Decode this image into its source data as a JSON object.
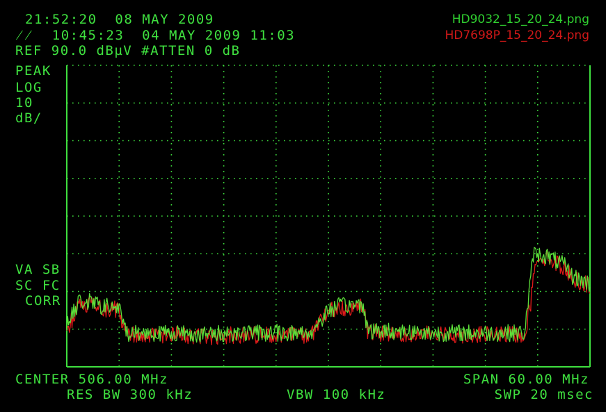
{
  "header": {
    "clock": "21:52:20  08 MAY 2009",
    "trace_stamp": "10:45:23  04 MAY 2009 11:03",
    "ref_line": "REF 90.0 dBµV #ATTEN 0 dB"
  },
  "files": {
    "green": "HD9032_15_20_24.png",
    "red": "HD7698P_15_20_24.png"
  },
  "left_labels": {
    "detector": "PEAK",
    "scale_type": "LOG",
    "scale_value": "10",
    "scale_unit": "dB/",
    "flags1": "VA SB",
    "flags2": "SC FC",
    "flags3": "CORR"
  },
  "footer": {
    "center": "CENTER 506.00 MHz",
    "span": "SPAN 60.00 MHz",
    "res_bw": "RES BW 300 kHz",
    "vbw": "VBW 100 kHz",
    "swp": "SWP 20 msec"
  },
  "colors": {
    "green_trace": "#5de03a",
    "red_trace": "#e01a1a",
    "text": "#3fe03f",
    "grid": "#3fe03f"
  },
  "chart_data": {
    "type": "line",
    "x_unit": "MHz",
    "y_unit": "dBµV",
    "xlim": [
      476,
      536
    ],
    "ylim": [
      10,
      90
    ],
    "grid": true,
    "series": [
      {
        "name": "HD9032_15_20_24.png",
        "color": "#5de03a",
        "x": [
          476,
          477.5,
          479,
          480,
          481,
          482,
          482.5,
          483,
          486,
          489,
          492,
          495,
          498,
          500,
          504,
          506,
          507,
          509,
          510,
          510.5,
          511,
          514,
          518,
          522,
          526,
          528.5,
          529,
          529.5,
          531,
          533,
          534,
          535,
          536
        ],
        "y": [
          21,
          27.5,
          27,
          26,
          26,
          25.5,
          21,
          19,
          19,
          19,
          18.5,
          19,
          19,
          19,
          19,
          25,
          26,
          26.5,
          26.5,
          20,
          19.5,
          19.5,
          19,
          19,
          19,
          19,
          29,
          40,
          39.5,
          37,
          34,
          33,
          32
        ]
      },
      {
        "name": "HD7698P_15_20_24.png",
        "color": "#e01a1a",
        "x": [
          476,
          477.5,
          479,
          480,
          481,
          482,
          482.5,
          483,
          486,
          489,
          492,
          495,
          498,
          500,
          504,
          506,
          507,
          509,
          510,
          510.5,
          511,
          514,
          518,
          522,
          526,
          528.5,
          529.2,
          529.8,
          531,
          533,
          534,
          535,
          536
        ],
        "y": [
          20,
          26.5,
          26.5,
          25.5,
          25.5,
          25,
          20.5,
          18.5,
          18.5,
          18.5,
          18,
          18.5,
          18.5,
          18.5,
          18.5,
          24.5,
          25.5,
          26,
          26,
          19.5,
          19,
          19,
          18.5,
          18.5,
          18.5,
          18.5,
          27,
          39,
          39,
          36.5,
          33.5,
          32.5,
          31.5
        ]
      }
    ]
  }
}
